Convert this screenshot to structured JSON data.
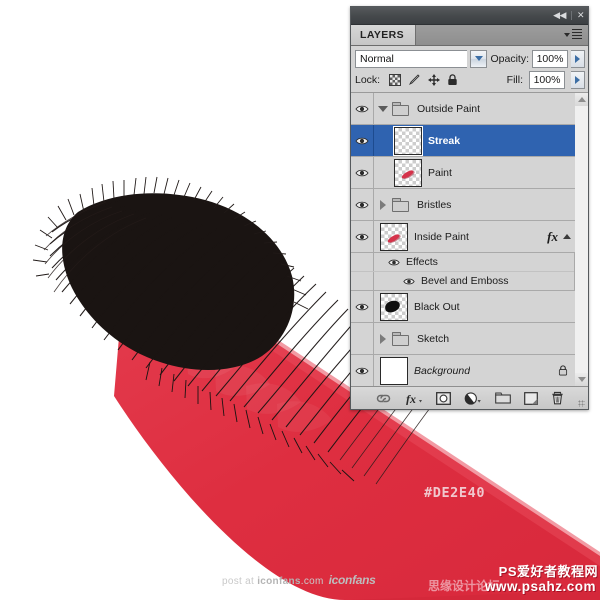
{
  "panel": {
    "title_tab": "LAYERS",
    "titlebar": {
      "collapse_label": "◀◀",
      "close_label": "✕"
    },
    "blend_row": {
      "blend_mode": "Normal",
      "opacity_label": "Opacity:",
      "opacity_value": "100%"
    },
    "lock_row": {
      "lock_label": "Lock:",
      "fill_label": "Fill:",
      "fill_value": "100%",
      "lock_icons": [
        "lock-transparent-pixels-icon",
        "lock-image-pixels-icon",
        "lock-position-icon",
        "lock-all-icon"
      ]
    },
    "layers": [
      {
        "name": "Outside Paint",
        "type": "group",
        "visible": true,
        "expanded": true,
        "selected": false,
        "thumb": "folder",
        "indent": 0
      },
      {
        "name": "Streak",
        "type": "layer",
        "visible": true,
        "selected": true,
        "thumb": "empty-transparent",
        "indent": 1
      },
      {
        "name": "Paint",
        "type": "layer",
        "visible": true,
        "selected": false,
        "thumb": "red-dab",
        "indent": 1
      },
      {
        "name": "Bristles",
        "type": "group",
        "visible": true,
        "expanded": false,
        "selected": false,
        "thumb": "folder",
        "indent": 0
      },
      {
        "name": "Inside Paint",
        "type": "layer",
        "visible": true,
        "selected": false,
        "thumb": "red-dab",
        "indent": 0,
        "fx": "fx"
      },
      {
        "name": "Effects",
        "type": "effects-group",
        "visible": true,
        "indent": 1
      },
      {
        "name": "Bevel and Emboss",
        "type": "effect",
        "visible": true,
        "indent": 2
      },
      {
        "name": "Black Out",
        "type": "layer",
        "visible": true,
        "selected": false,
        "thumb": "black-blob",
        "indent": 0
      },
      {
        "name": "Sketch",
        "type": "group",
        "visible": false,
        "expanded": false,
        "selected": false,
        "thumb": "folder",
        "indent": 0
      },
      {
        "name": "Background",
        "type": "layer",
        "visible": true,
        "selected": false,
        "thumb": "white",
        "indent": 0,
        "locked": true,
        "italic": true
      }
    ],
    "footer_icons": [
      "link-layers-icon",
      "add-layer-style-icon",
      "add-layer-mask-icon",
      "new-fill-adjustment-layer-icon",
      "new-group-icon",
      "new-layer-icon",
      "delete-layer-icon"
    ],
    "scrollbar": {
      "up_arrow": "scroll-up-icon",
      "down_arrow": "scroll-down-icon"
    }
  },
  "annotations": {
    "hex_swatch_label": "#DE2E40",
    "watermark_iconfans_prefix": "post at ",
    "watermark_iconfans_brand": "iconfans",
    "watermark_iconfans_suffix": ".com",
    "watermark_iconfans_logo": "iconfans",
    "watermark_cn_title": "PS爱好者教程网",
    "watermark_cn_forum": "思缘设计论坛",
    "watermark_cn_url": "www.psahz.com"
  },
  "colors": {
    "paint_red": "#DE2E40",
    "bristle_black": "#1a1412",
    "panel_bg": "#D4D4D4",
    "selection_blue": "#2F63B0",
    "titlebar_dark": "#45484B"
  },
  "artwork": {
    "description": "paintbrush-stroke-illustration",
    "elements": [
      "brush-bristles",
      "red-paint-stroke",
      "paint-highlights"
    ]
  }
}
